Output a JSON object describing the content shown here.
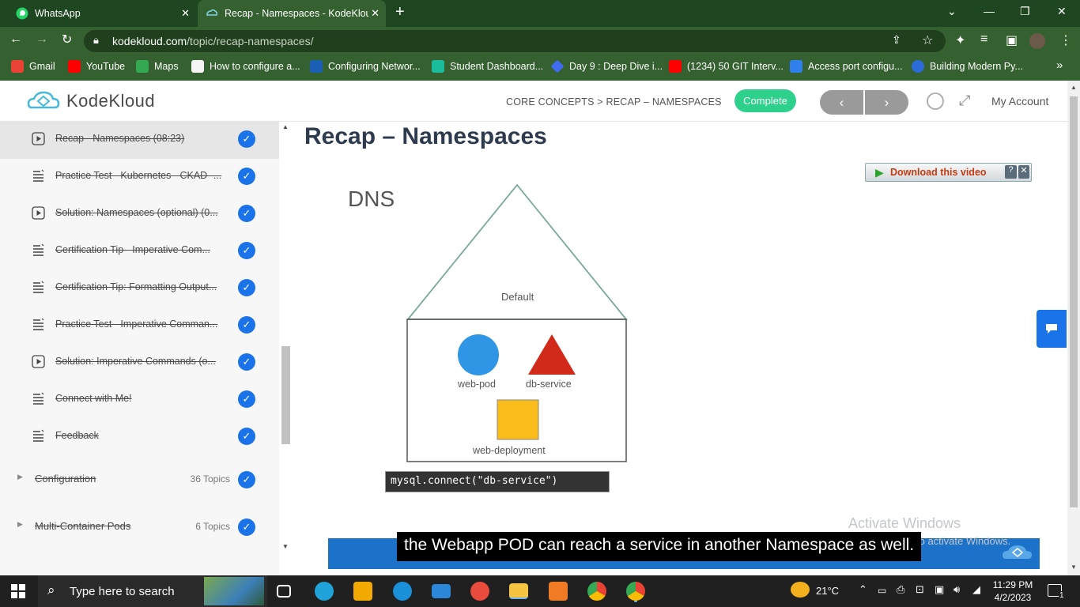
{
  "browser": {
    "tabs": [
      {
        "title": "WhatsApp",
        "close": "✕"
      },
      {
        "title": "Recap - Namespaces - KodeKlou",
        "close": "✕"
      }
    ],
    "new_tab": "+",
    "url_host": "kodekloud.com",
    "url_path": "/topic/recap-namespaces/",
    "bookmarks": [
      {
        "label": "Gmail",
        "color": "#ea4335"
      },
      {
        "label": "YouTube",
        "color": "#ff0000"
      },
      {
        "label": "Maps",
        "color": "#34a853"
      },
      {
        "label": "How to configure a...",
        "color": "#f5f5f5"
      },
      {
        "label": "Configuring Networ...",
        "color": "#1a5fb4"
      },
      {
        "label": "Student Dashboard...",
        "color": "#1abc9c"
      },
      {
        "label": "Day 9 : Deep Dive i...",
        "color": "#3e6bf0"
      },
      {
        "label": "(1234) 50 GIT Interv...",
        "color": "#ff0000"
      },
      {
        "label": "Access port configu...",
        "color": "#2f80ed"
      },
      {
        "label": "Building Modern Py...",
        "color": "#2a6bd8"
      }
    ],
    "more": "»"
  },
  "header": {
    "logo": "KodeKloud",
    "breadcrumb": "CORE CONCEPTS > RECAP – NAMESPACES",
    "complete_label": "Complete",
    "prev": "‹",
    "next": "›",
    "account": "My Account"
  },
  "sidebar": {
    "items": [
      {
        "label": "Recap - Namespaces (08:23)",
        "icon": "play-icon"
      },
      {
        "label": "Practice Test - Kubernetes - CKAD -...",
        "icon": "doc-icon"
      },
      {
        "label": "Solution: Namespaces (optional) (0...",
        "icon": "play-icon"
      },
      {
        "label": "Certification Tip - Imperative Com...",
        "icon": "doc-icon"
      },
      {
        "label": "Certification Tip: Formatting Output...",
        "icon": "doc-icon"
      },
      {
        "label": "Practice Test - Imperative Comman...",
        "icon": "doc-icon"
      },
      {
        "label": "Solution: Imperative Commands (o...",
        "icon": "play-icon"
      },
      {
        "label": "Connect with Me!",
        "icon": "doc-icon"
      },
      {
        "label": "Feedback",
        "icon": "doc-icon"
      }
    ],
    "sections": [
      {
        "label": "Configuration",
        "count": "36 Topics"
      },
      {
        "label": "Multi-Container Pods",
        "count": "6 Topics"
      }
    ],
    "check": "✓"
  },
  "main": {
    "title": "Recap – Namespaces",
    "download_label": "Download this video",
    "video": {
      "dns": "DNS",
      "default_label": "Default",
      "pod_label": "web-pod",
      "service_label": "db-service",
      "deployment_label": "web-deployment",
      "code": "mysql.connect(\"db-service\")",
      "caption": "the Webapp POD can reach a service in another Namespace as well."
    },
    "activate_title": "Activate Windows",
    "activate_sub": "Go to Settings to activate Windows."
  },
  "taskbar": {
    "search_placeholder": "Type here to search",
    "temperature": "21°C",
    "time": "11:29 PM",
    "date": "4/2/2023",
    "notif_count": "1"
  }
}
